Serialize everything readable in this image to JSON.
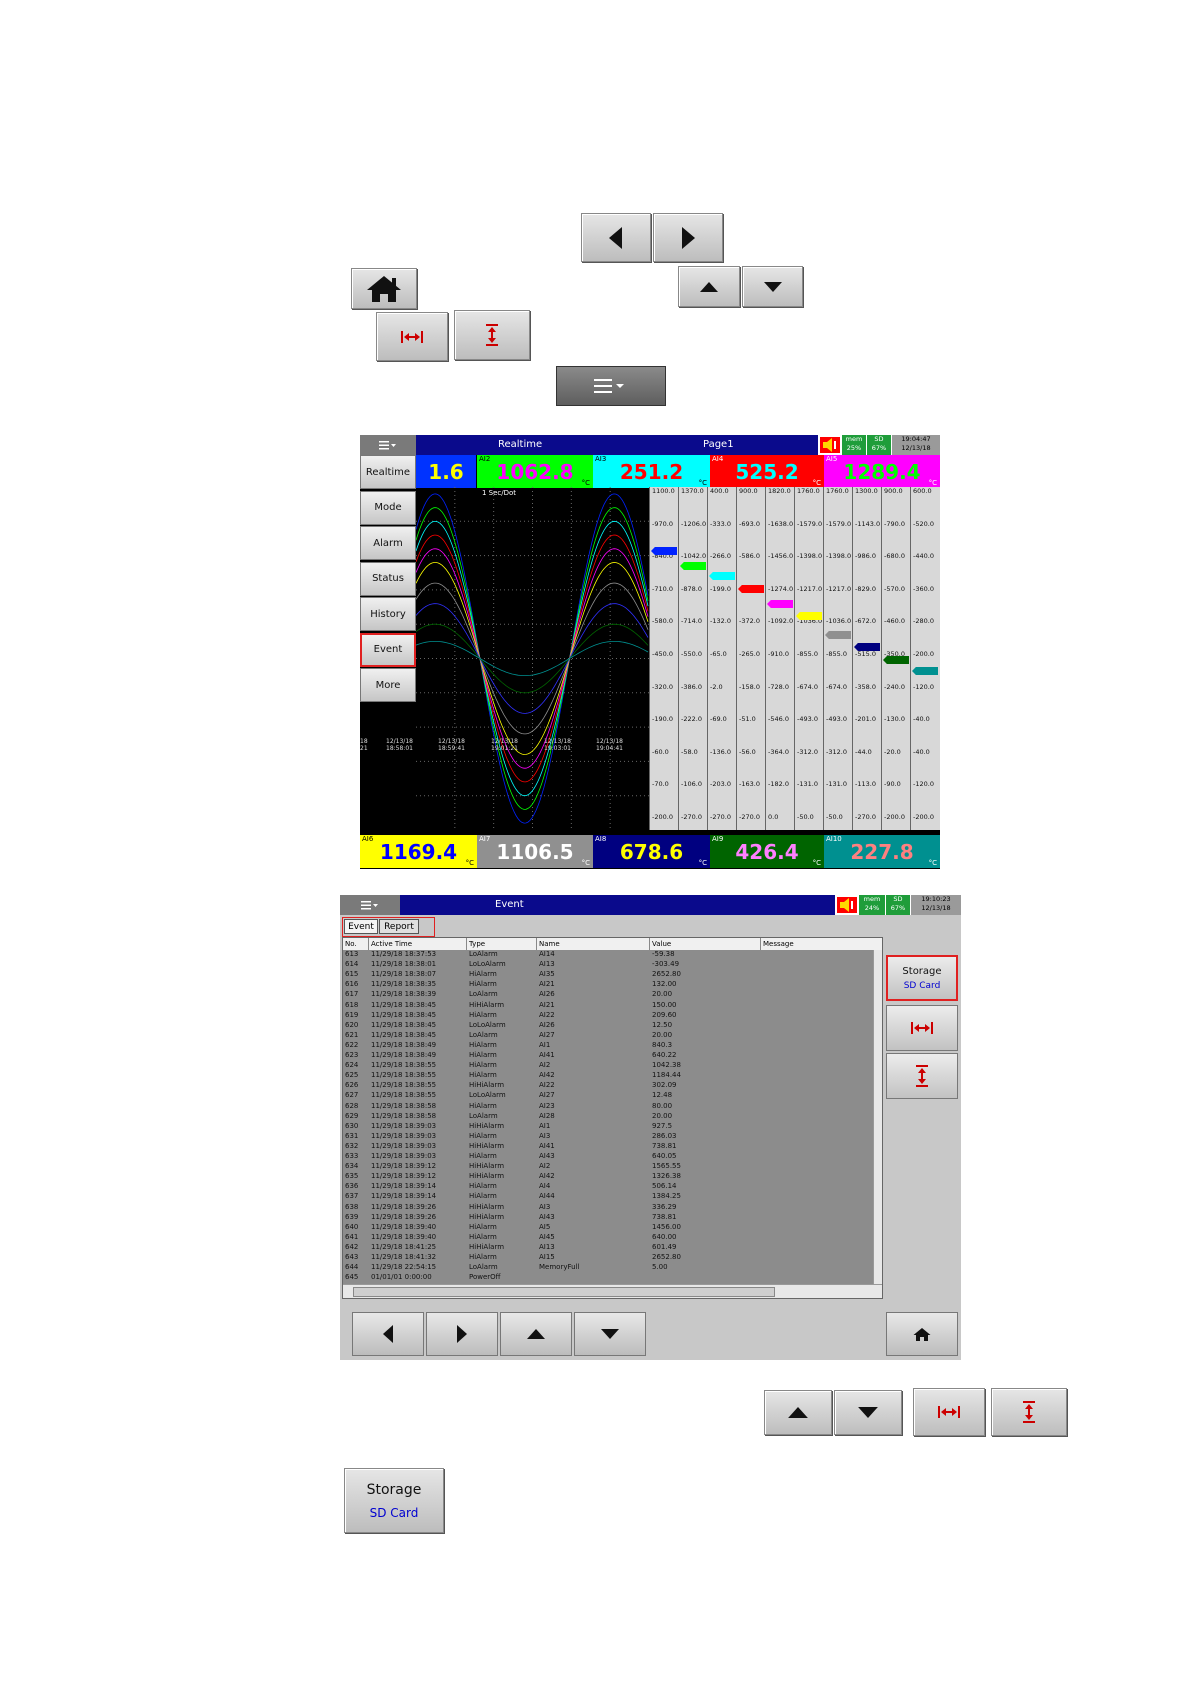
{
  "top_icons": {
    "left_arrow": "left-arrow-icon",
    "right_arrow": "right-arrow-icon",
    "home": "home-icon",
    "up_arrow": "up-arrow-icon",
    "down_arrow": "down-arrow-icon",
    "h_zoom": "horizontal-zoom-icon",
    "v_zoom": "vertical-zoom-icon",
    "menu": "menu-icon"
  },
  "realtime_screen": {
    "title": "Realtime",
    "page": "Page1",
    "mem_label": "mem",
    "sd_label": "SD",
    "mem_pct": "25%",
    "sd_pct": "67%",
    "time": "19:04:47",
    "date": "12/13/18",
    "sidebar": [
      "Realtime",
      "Mode",
      "Alarm",
      "Status",
      "History",
      "Event",
      "More"
    ],
    "rate": "1 Sec/Dot",
    "top_values": [
      {
        "tag": "",
        "value": "1.6",
        "unit": "",
        "bg": "#0033ff",
        "fg": "#ffff00"
      },
      {
        "tag": "AI2",
        "value": "1062.8",
        "unit": "°C",
        "bg": "#00ff00",
        "fg": "#ff00ff"
      },
      {
        "tag": "AI3",
        "value": "251.2",
        "unit": "°C",
        "bg": "#00ffff",
        "fg": "#ff0000"
      },
      {
        "tag": "AI4",
        "value": "525.2",
        "unit": "°C",
        "bg": "#ff0000",
        "fg": "#00ffff"
      },
      {
        "tag": "AI5",
        "value": "1289.4",
        "unit": "°C",
        "bg": "#ff00ff",
        "fg": "#00ff00"
      }
    ],
    "bottom_values": [
      {
        "tag": "AI6",
        "value": "1169.4",
        "unit": "°C",
        "bg": "#ffff00",
        "fg": "#0000ff"
      },
      {
        "tag": "AI7",
        "value": "1106.5",
        "unit": "°C",
        "bg": "#909090",
        "fg": "#ffffff"
      },
      {
        "tag": "AI8",
        "value": "678.6",
        "unit": "°C",
        "bg": "#000080",
        "fg": "#ffff00"
      },
      {
        "tag": "AI9",
        "value": "426.4",
        "unit": "°C",
        "bg": "#006400",
        "fg": "#ff80ff"
      },
      {
        "tag": "AI10",
        "value": "227.8",
        "unit": "°C",
        "bg": "#009090",
        "fg": "#ff8080"
      }
    ],
    "time_labels": [
      "18\n21",
      "12/13/18\n18:58:01",
      "12/13/18\n18:59:41",
      "12/13/18\n19:01:21",
      "12/13/18\n19:03:01",
      "12/13/18\n19:04:41"
    ],
    "scales": [
      [
        "1100.0",
        "-970.0",
        "-840.0",
        "-710.0",
        "-580.0",
        "-450.0",
        "-320.0",
        "-190.0",
        "-60.0",
        "-70.0",
        "-200.0"
      ],
      [
        "1370.0",
        "-1206.0",
        "-1042.0",
        "-878.0",
        "-714.0",
        "-550.0",
        "-386.0",
        "-222.0",
        "-58.0",
        "-106.0",
        "-270.0"
      ],
      [
        "400.0",
        "-333.0",
        "-266.0",
        "-199.0",
        "-132.0",
        "-65.0",
        "-2.0",
        "-69.0",
        "-136.0",
        "-203.0",
        "-270.0"
      ],
      [
        "900.0",
        "-693.0",
        "-586.0",
        "-479.0",
        "-372.0",
        "-265.0",
        "-158.0",
        "-51.0",
        "-56.0",
        "-163.0",
        "-270.0"
      ],
      [
        "1820.0",
        "-1638.0",
        "-1456.0",
        "-1274.0",
        "-1092.0",
        "-910.0",
        "-728.0",
        "-546.0",
        "-364.0",
        "-182.0",
        "0.0"
      ],
      [
        "1760.0",
        "-1579.0",
        "-1398.0",
        "-1217.0",
        "-1036.0",
        "-855.0",
        "-674.0",
        "-493.0",
        "-312.0",
        "-131.0",
        "-50.0"
      ],
      [
        "1760.0",
        "-1579.0",
        "-1398.0",
        "-1217.0",
        "-1036.0",
        "-855.0",
        "-674.0",
        "-493.0",
        "-312.0",
        "-131.0",
        "-50.0"
      ],
      [
        "1300.0",
        "-1143.0",
        "-986.0",
        "-829.0",
        "-672.0",
        "-515.0",
        "-358.0",
        "-201.0",
        "-44.0",
        "-113.0",
        "-270.0"
      ],
      [
        "900.0",
        "-790.0",
        "-680.0",
        "-570.0",
        "-460.0",
        "-350.0",
        "-240.0",
        "-130.0",
        "-20.0",
        "-90.0",
        "-200.0"
      ],
      [
        "600.0",
        "-520.0",
        "-440.0",
        "-360.0",
        "-280.0",
        "-200.0",
        "-120.0",
        "-40.0",
        "-40.0",
        "-120.0",
        "-200.0"
      ]
    ],
    "marker_colors": [
      "#0022ff",
      "#00ff00",
      "#00ffff",
      "#ff0000",
      "#ff00ff",
      "#ffff00",
      "#909090",
      "#000080",
      "#006400",
      "#009090"
    ]
  },
  "event_screen": {
    "title": "Event",
    "mem_label": "mem",
    "sd_label": "SD",
    "mem_pct": "24%",
    "sd_pct": "67%",
    "time": "19:10:23",
    "date": "12/13/18",
    "tabs": [
      "Event",
      "Report"
    ],
    "columns": [
      "No.",
      "Active Time",
      "Type",
      "Name",
      "Value",
      "Message"
    ],
    "rows": [
      [
        "613",
        "11/29/18 18:37:53",
        "LoAlarm",
        "AI14",
        "-59.38",
        ""
      ],
      [
        "614",
        "11/29/18 18:38:01",
        "LoLoAlarm",
        "AI13",
        "-303.49",
        ""
      ],
      [
        "615",
        "11/29/18 18:38:07",
        "HiAlarm",
        "AI35",
        "2652.80",
        ""
      ],
      [
        "616",
        "11/29/18 18:38:35",
        "HiAlarm",
        "AI21",
        "132.00",
        ""
      ],
      [
        "617",
        "11/29/18 18:38:39",
        "LoAlarm",
        "AI26",
        "20.00",
        ""
      ],
      [
        "618",
        "11/29/18 18:38:45",
        "HiHiAlarm",
        "AI21",
        "150.00",
        ""
      ],
      [
        "619",
        "11/29/18 18:38:45",
        "HiAlarm",
        "AI22",
        "209.60",
        ""
      ],
      [
        "620",
        "11/29/18 18:38:45",
        "LoLoAlarm",
        "AI26",
        "12.50",
        ""
      ],
      [
        "621",
        "11/29/18 18:38:45",
        "LoAlarm",
        "AI27",
        "20.00",
        ""
      ],
      [
        "622",
        "11/29/18 18:38:49",
        "HiAlarm",
        "AI1",
        "840.3",
        ""
      ],
      [
        "623",
        "11/29/18 18:38:49",
        "HiAlarm",
        "AI41",
        "640.22",
        ""
      ],
      [
        "624",
        "11/29/18 18:38:55",
        "HiAlarm",
        "AI2",
        "1042.38",
        ""
      ],
      [
        "625",
        "11/29/18 18:38:55",
        "HiAlarm",
        "AI42",
        "1184.44",
        ""
      ],
      [
        "626",
        "11/29/18 18:38:55",
        "HiHiAlarm",
        "AI22",
        "302.09",
        ""
      ],
      [
        "627",
        "11/29/18 18:38:55",
        "LoLoAlarm",
        "AI27",
        "12.48",
        ""
      ],
      [
        "628",
        "11/29/18 18:38:58",
        "HiAlarm",
        "AI23",
        "80.00",
        ""
      ],
      [
        "629",
        "11/29/18 18:38:58",
        "LoAlarm",
        "AI28",
        "20.00",
        ""
      ],
      [
        "630",
        "11/29/18 18:39:03",
        "HiHiAlarm",
        "AI1",
        "927.5",
        ""
      ],
      [
        "631",
        "11/29/18 18:39:03",
        "HiAlarm",
        "AI3",
        "286.03",
        ""
      ],
      [
        "632",
        "11/29/18 18:39:03",
        "HiHiAlarm",
        "AI41",
        "738.81",
        ""
      ],
      [
        "633",
        "11/29/18 18:39:03",
        "HiAlarm",
        "AI43",
        "640.05",
        ""
      ],
      [
        "634",
        "11/29/18 18:39:12",
        "HiHiAlarm",
        "AI2",
        "1565.55",
        ""
      ],
      [
        "635",
        "11/29/18 18:39:12",
        "HiHiAlarm",
        "AI42",
        "1326.38",
        ""
      ],
      [
        "636",
        "11/29/18 18:39:14",
        "HiAlarm",
        "AI4",
        "506.14",
        ""
      ],
      [
        "637",
        "11/29/18 18:39:14",
        "HiAlarm",
        "AI44",
        "1384.25",
        ""
      ],
      [
        "638",
        "11/29/18 18:39:26",
        "HiHiAlarm",
        "AI3",
        "336.29",
        ""
      ],
      [
        "639",
        "11/29/18 18:39:26",
        "HiHiAlarm",
        "AI43",
        "738.81",
        ""
      ],
      [
        "640",
        "11/29/18 18:39:40",
        "HiAlarm",
        "AI5",
        "1456.00",
        ""
      ],
      [
        "641",
        "11/29/18 18:39:40",
        "HiAlarm",
        "AI45",
        "640.00",
        ""
      ],
      [
        "642",
        "11/29/18 18:41:25",
        "HiHiAlarm",
        "AI13",
        "601.49",
        ""
      ],
      [
        "643",
        "11/29/18 18:41:32",
        "HiAlarm",
        "AI15",
        "2652.80",
        ""
      ],
      [
        "644",
        "11/29/18 22:54:15",
        "LoAlarm",
        "MemoryFull",
        "5.00",
        ""
      ],
      [
        "645",
        "01/01/01 0:00:00",
        "PowerOff",
        "",
        "",
        ""
      ]
    ],
    "storage_label": "Storage",
    "storage_value": "SD Card"
  },
  "bottom_buttons": {
    "storage_label": "Storage",
    "storage_value": "SD Card"
  }
}
